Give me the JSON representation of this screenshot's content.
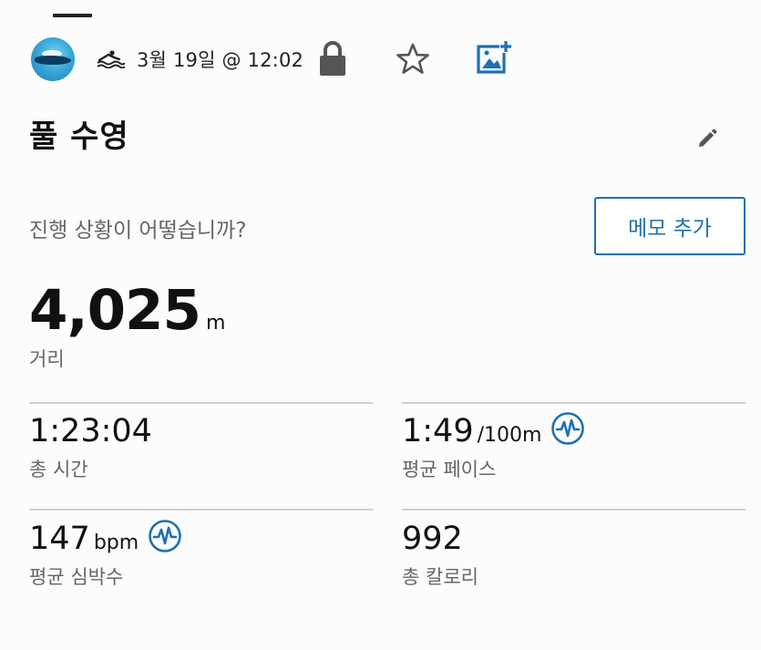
{
  "header": {
    "date": "3월 19일 @ 12:02",
    "avatar_icon": "swimmer-avatar",
    "activity_type_icon": "pool-swim-icon",
    "lock_icon": "lock-icon",
    "favorite_icon": "star-icon",
    "add_photo_icon": "add-photo-icon"
  },
  "activity": {
    "title": "풀 수영",
    "edit_icon": "pencil-icon"
  },
  "notes": {
    "prompt": "진행 상황이 어떻습니까?",
    "add_note_label": "메모 추가"
  },
  "distance": {
    "value": "4,025",
    "unit": "m",
    "label": "거리"
  },
  "stats": {
    "total_time": {
      "value": "1:23:04",
      "label": "총 시간"
    },
    "avg_pace": {
      "value": "1:49",
      "unit": "/100m",
      "label": "평균 페이스"
    },
    "avg_hr": {
      "value": "147",
      "unit": "bpm",
      "label": "평균 심박수"
    },
    "calories": {
      "value": "992",
      "label": "총 칼로리"
    }
  },
  "colors": {
    "accent": "#1f6fb2",
    "text_primary": "#111111",
    "text_secondary": "#666666",
    "divider": "#cfcfcf"
  }
}
